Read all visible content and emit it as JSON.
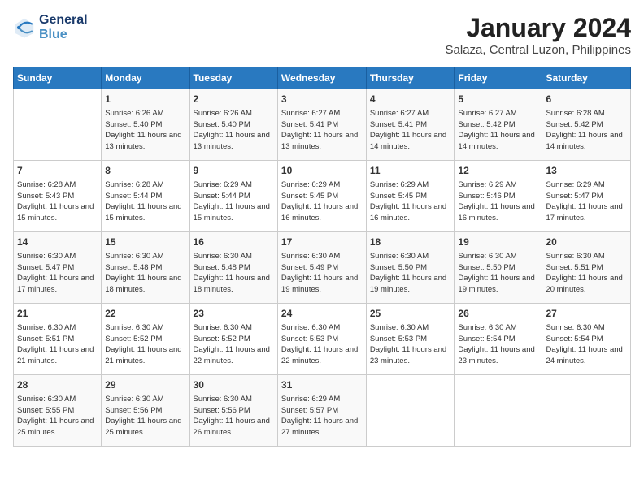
{
  "header": {
    "logo_line1": "General",
    "logo_line2": "Blue",
    "month": "January 2024",
    "location": "Salaza, Central Luzon, Philippines"
  },
  "weekdays": [
    "Sunday",
    "Monday",
    "Tuesday",
    "Wednesday",
    "Thursday",
    "Friday",
    "Saturday"
  ],
  "weeks": [
    [
      {
        "day": "",
        "sunrise": "",
        "sunset": "",
        "daylight": ""
      },
      {
        "day": "1",
        "sunrise": "6:26 AM",
        "sunset": "5:40 PM",
        "daylight": "11 hours and 13 minutes."
      },
      {
        "day": "2",
        "sunrise": "6:26 AM",
        "sunset": "5:40 PM",
        "daylight": "11 hours and 13 minutes."
      },
      {
        "day": "3",
        "sunrise": "6:27 AM",
        "sunset": "5:41 PM",
        "daylight": "11 hours and 13 minutes."
      },
      {
        "day": "4",
        "sunrise": "6:27 AM",
        "sunset": "5:41 PM",
        "daylight": "11 hours and 14 minutes."
      },
      {
        "day": "5",
        "sunrise": "6:27 AM",
        "sunset": "5:42 PM",
        "daylight": "11 hours and 14 minutes."
      },
      {
        "day": "6",
        "sunrise": "6:28 AM",
        "sunset": "5:42 PM",
        "daylight": "11 hours and 14 minutes."
      }
    ],
    [
      {
        "day": "7",
        "sunrise": "6:28 AM",
        "sunset": "5:43 PM",
        "daylight": "11 hours and 15 minutes."
      },
      {
        "day": "8",
        "sunrise": "6:28 AM",
        "sunset": "5:44 PM",
        "daylight": "11 hours and 15 minutes."
      },
      {
        "day": "9",
        "sunrise": "6:29 AM",
        "sunset": "5:44 PM",
        "daylight": "11 hours and 15 minutes."
      },
      {
        "day": "10",
        "sunrise": "6:29 AM",
        "sunset": "5:45 PM",
        "daylight": "11 hours and 16 minutes."
      },
      {
        "day": "11",
        "sunrise": "6:29 AM",
        "sunset": "5:45 PM",
        "daylight": "11 hours and 16 minutes."
      },
      {
        "day": "12",
        "sunrise": "6:29 AM",
        "sunset": "5:46 PM",
        "daylight": "11 hours and 16 minutes."
      },
      {
        "day": "13",
        "sunrise": "6:29 AM",
        "sunset": "5:47 PM",
        "daylight": "11 hours and 17 minutes."
      }
    ],
    [
      {
        "day": "14",
        "sunrise": "6:30 AM",
        "sunset": "5:47 PM",
        "daylight": "11 hours and 17 minutes."
      },
      {
        "day": "15",
        "sunrise": "6:30 AM",
        "sunset": "5:48 PM",
        "daylight": "11 hours and 18 minutes."
      },
      {
        "day": "16",
        "sunrise": "6:30 AM",
        "sunset": "5:48 PM",
        "daylight": "11 hours and 18 minutes."
      },
      {
        "day": "17",
        "sunrise": "6:30 AM",
        "sunset": "5:49 PM",
        "daylight": "11 hours and 19 minutes."
      },
      {
        "day": "18",
        "sunrise": "6:30 AM",
        "sunset": "5:50 PM",
        "daylight": "11 hours and 19 minutes."
      },
      {
        "day": "19",
        "sunrise": "6:30 AM",
        "sunset": "5:50 PM",
        "daylight": "11 hours and 19 minutes."
      },
      {
        "day": "20",
        "sunrise": "6:30 AM",
        "sunset": "5:51 PM",
        "daylight": "11 hours and 20 minutes."
      }
    ],
    [
      {
        "day": "21",
        "sunrise": "6:30 AM",
        "sunset": "5:51 PM",
        "daylight": "11 hours and 21 minutes."
      },
      {
        "day": "22",
        "sunrise": "6:30 AM",
        "sunset": "5:52 PM",
        "daylight": "11 hours and 21 minutes."
      },
      {
        "day": "23",
        "sunrise": "6:30 AM",
        "sunset": "5:52 PM",
        "daylight": "11 hours and 22 minutes."
      },
      {
        "day": "24",
        "sunrise": "6:30 AM",
        "sunset": "5:53 PM",
        "daylight": "11 hours and 22 minutes."
      },
      {
        "day": "25",
        "sunrise": "6:30 AM",
        "sunset": "5:53 PM",
        "daylight": "11 hours and 23 minutes."
      },
      {
        "day": "26",
        "sunrise": "6:30 AM",
        "sunset": "5:54 PM",
        "daylight": "11 hours and 23 minutes."
      },
      {
        "day": "27",
        "sunrise": "6:30 AM",
        "sunset": "5:54 PM",
        "daylight": "11 hours and 24 minutes."
      }
    ],
    [
      {
        "day": "28",
        "sunrise": "6:30 AM",
        "sunset": "5:55 PM",
        "daylight": "11 hours and 25 minutes."
      },
      {
        "day": "29",
        "sunrise": "6:30 AM",
        "sunset": "5:56 PM",
        "daylight": "11 hours and 25 minutes."
      },
      {
        "day": "30",
        "sunrise": "6:30 AM",
        "sunset": "5:56 PM",
        "daylight": "11 hours and 26 minutes."
      },
      {
        "day": "31",
        "sunrise": "6:29 AM",
        "sunset": "5:57 PM",
        "daylight": "11 hours and 27 minutes."
      },
      {
        "day": "",
        "sunrise": "",
        "sunset": "",
        "daylight": ""
      },
      {
        "day": "",
        "sunrise": "",
        "sunset": "",
        "daylight": ""
      },
      {
        "day": "",
        "sunrise": "",
        "sunset": "",
        "daylight": ""
      }
    ]
  ]
}
